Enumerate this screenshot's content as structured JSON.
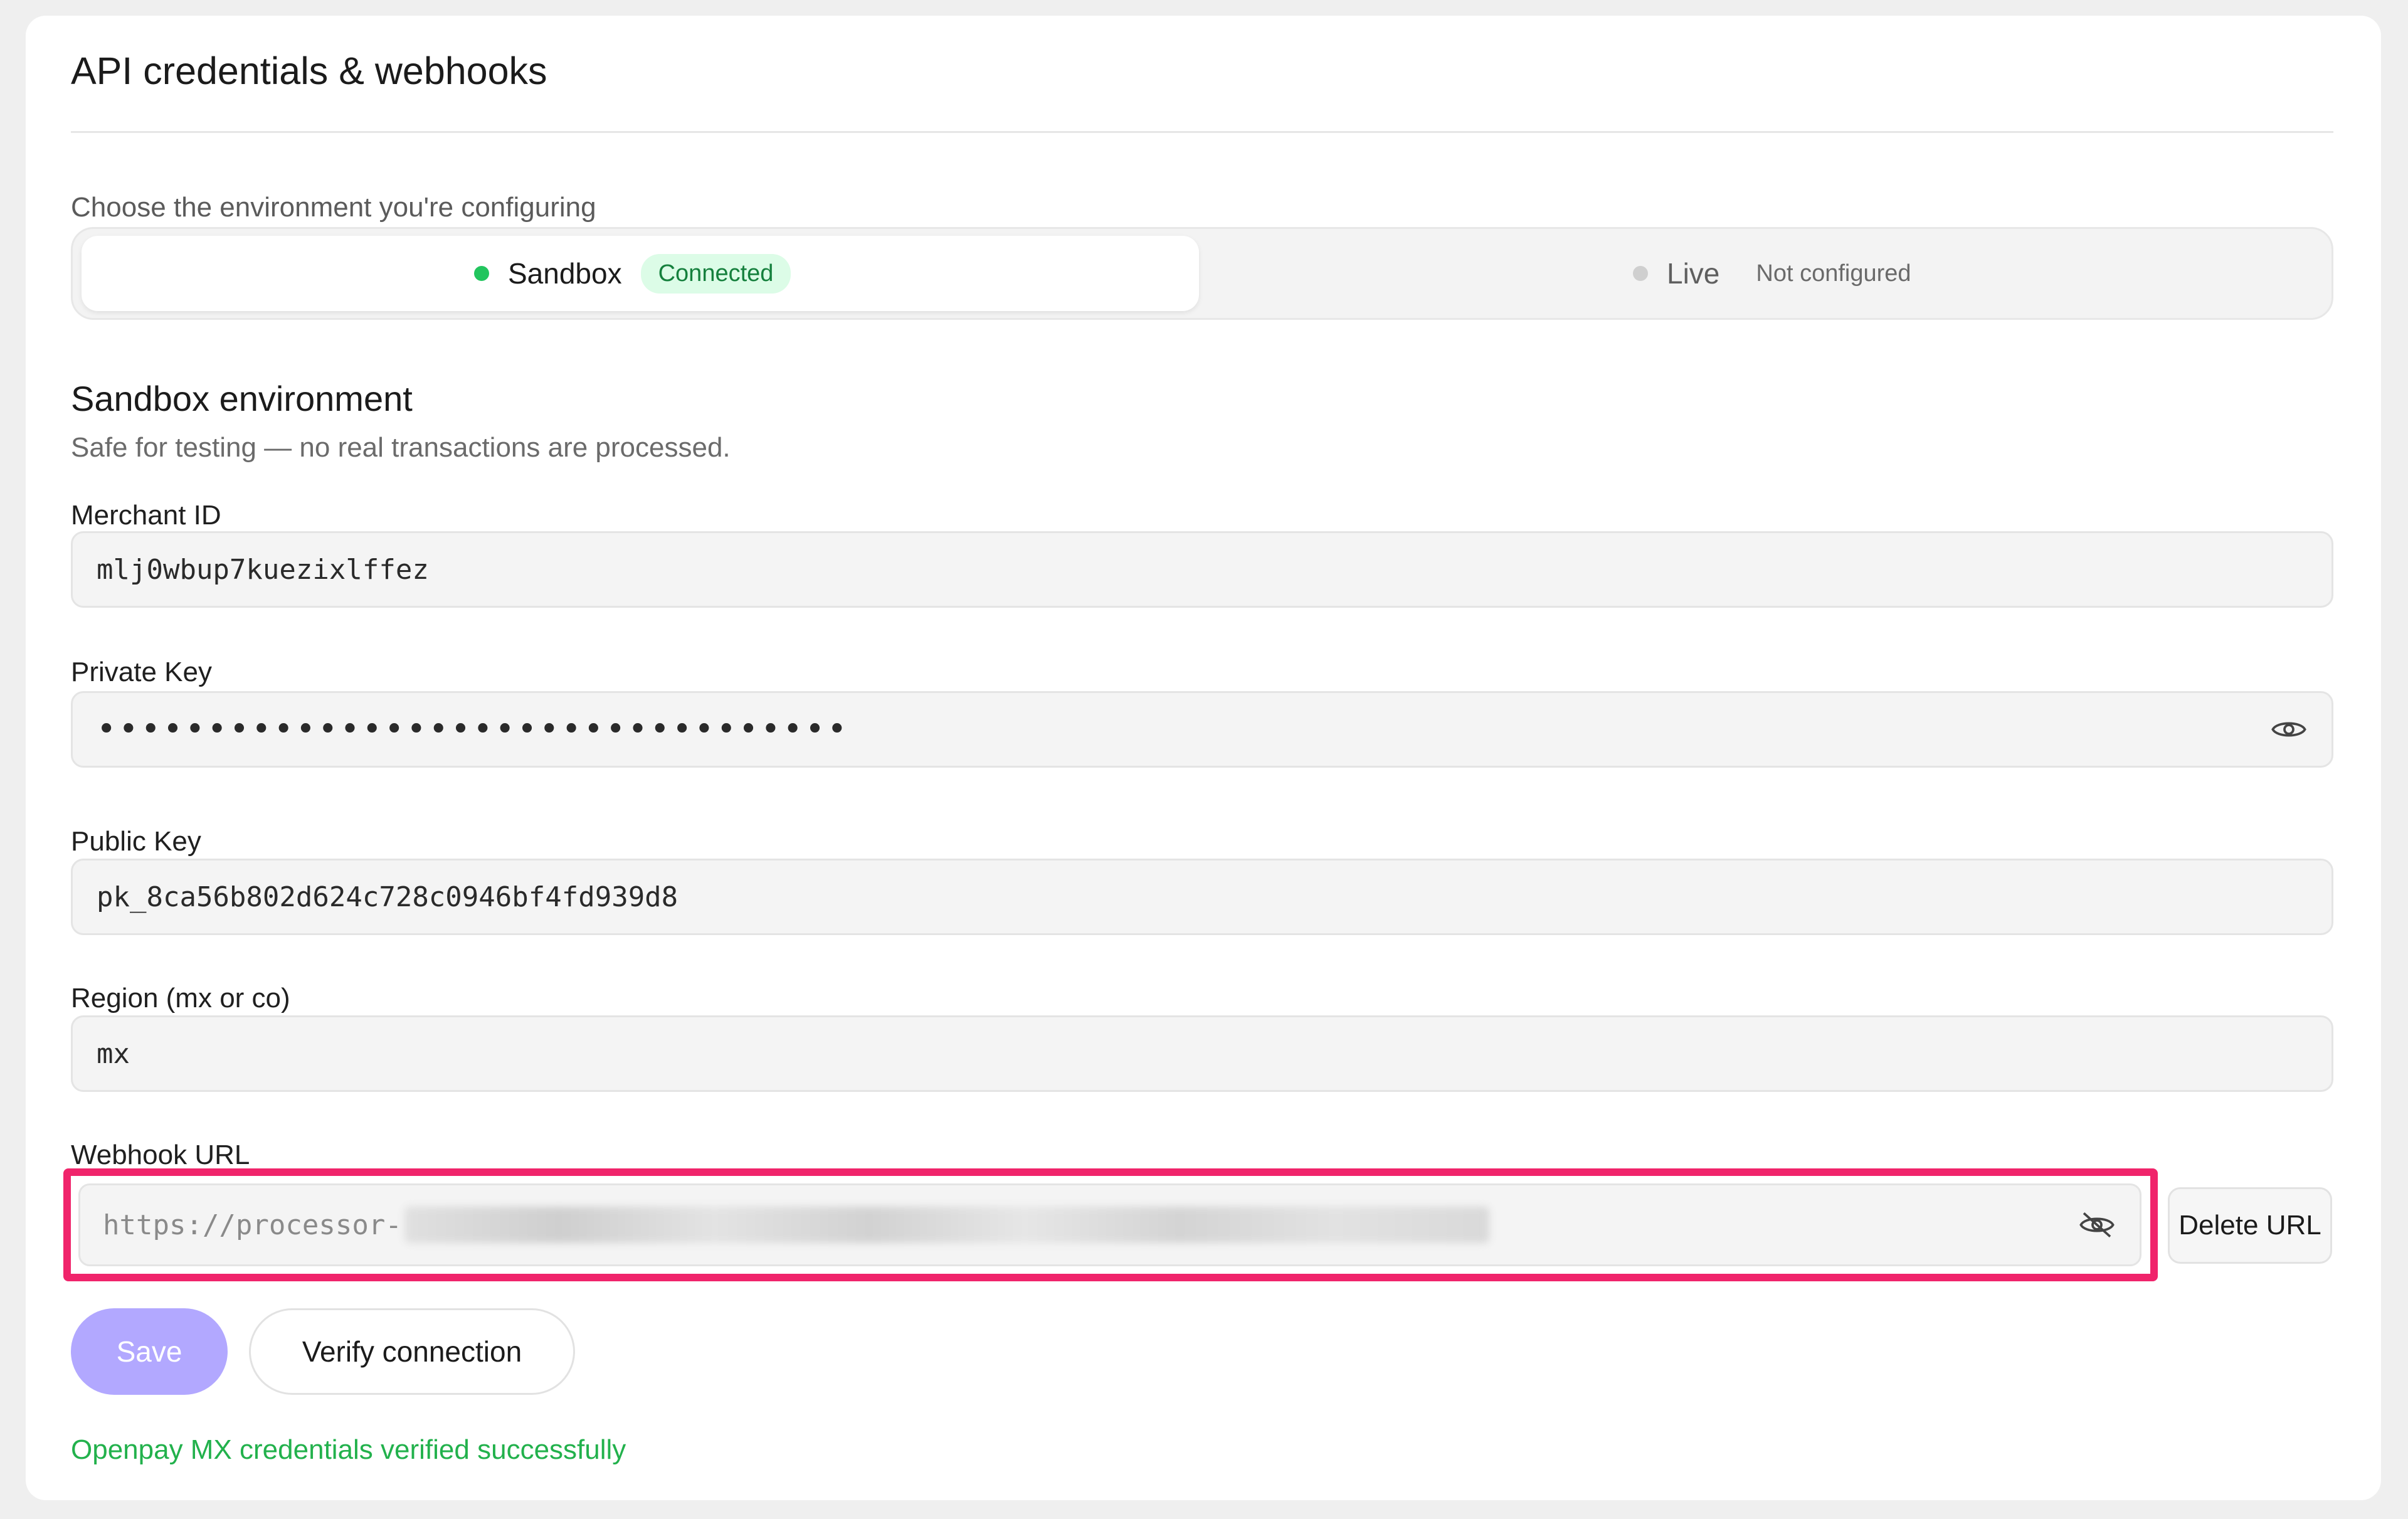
{
  "header": {
    "title": "API credentials & webhooks"
  },
  "environment": {
    "prompt": "Choose the environment you're configuring",
    "options": [
      {
        "name": "Sandbox",
        "status": "Connected",
        "active": true
      },
      {
        "name": "Live",
        "status": "Not configured",
        "active": false
      }
    ]
  },
  "section": {
    "title": "Sandbox environment",
    "subtitle": "Safe for testing — no real transactions are processed."
  },
  "fields": {
    "merchant_id": {
      "label": "Merchant ID",
      "value": "mlj0wbup7kuezixlffez"
    },
    "private_key": {
      "label": "Private Key",
      "value": "••••••••••••••••••••••••••••••••••"
    },
    "public_key": {
      "label": "Public Key",
      "value": "pk_8ca56b802d624c728c0946bf4fd939d8"
    },
    "region": {
      "label": "Region (mx or co)",
      "value": "mx"
    },
    "webhook_url": {
      "label": "Webhook URL",
      "value": "https://processor-"
    }
  },
  "actions": {
    "delete_url": "Delete URL",
    "save": "Save",
    "verify": "Verify connection"
  },
  "status_message": "Openpay MX credentials verified successfully",
  "icons": {
    "private_key_toggle": "eye-icon",
    "webhook_toggle": "eye-off-icon"
  },
  "colors": {
    "accent_primary": "#b2a8ff",
    "success": "#22c55e",
    "highlight": "#f0246b"
  }
}
